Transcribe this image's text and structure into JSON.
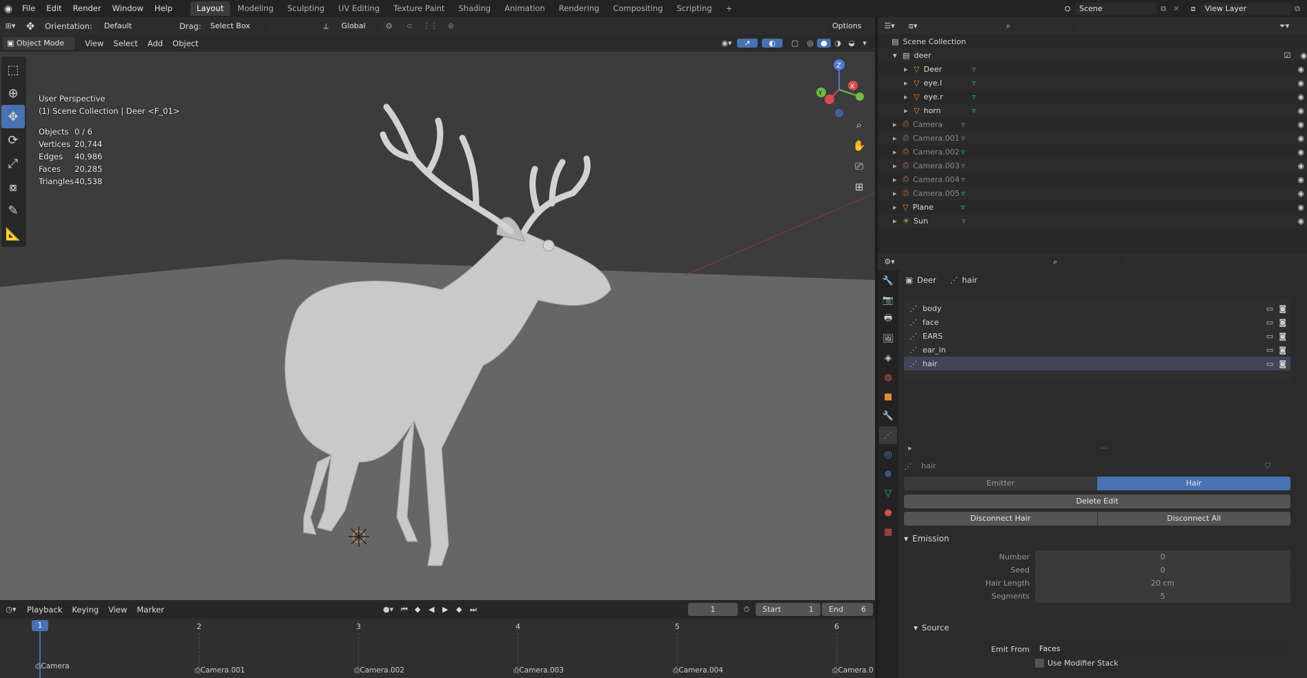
{
  "topbar": {
    "menus": [
      "File",
      "Edit",
      "Render",
      "Window",
      "Help"
    ],
    "workspaces": [
      "Layout",
      "Modeling",
      "Sculpting",
      "UV Editing",
      "Texture Paint",
      "Shading",
      "Animation",
      "Rendering",
      "Compositing",
      "Scripting"
    ],
    "add_tab": "+",
    "scene": "Scene",
    "view_layer": "View Layer"
  },
  "tool_header": {
    "orientation_label": "Orientation:",
    "orientation_value": "Default",
    "drag_label": "Drag:",
    "drag_value": "Select Box",
    "transform_space": "Global",
    "options": "Options"
  },
  "viewport_header": {
    "mode": "Object Mode",
    "menus": [
      "View",
      "Select",
      "Add",
      "Object"
    ]
  },
  "overlay": {
    "perspective": "User Perspective",
    "collection": "(1) Scene Collection | Deer <F_01>",
    "stats": [
      {
        "label": "Objects",
        "value": "0 / 6"
      },
      {
        "label": "Vertices",
        "value": "20,744"
      },
      {
        "label": "Edges",
        "value": "40,986"
      },
      {
        "label": "Faces",
        "value": "20,285"
      },
      {
        "label": "Triangles",
        "value": "40,538"
      }
    ],
    "axes": {
      "z": "Z",
      "y": "Y",
      "x": "X"
    }
  },
  "outliner": {
    "root": "Scene Collection",
    "collection": "deer",
    "items": [
      {
        "name": "Deer",
        "kind": "mesh"
      },
      {
        "name": "eye.l",
        "kind": "mesh"
      },
      {
        "name": "eye.r",
        "kind": "mesh"
      },
      {
        "name": "horn",
        "kind": "mesh"
      },
      {
        "name": "Camera",
        "kind": "camera"
      },
      {
        "name": "Camera.001",
        "kind": "camera"
      },
      {
        "name": "Camera.002",
        "kind": "camera"
      },
      {
        "name": "Camera.003",
        "kind": "camera"
      },
      {
        "name": "Camera.004",
        "kind": "camera"
      },
      {
        "name": "Camera.005",
        "kind": "camera"
      },
      {
        "name": "Plane",
        "kind": "mesh"
      },
      {
        "name": "Sun",
        "kind": "light"
      }
    ]
  },
  "properties": {
    "breadcrumb_object": "Deer",
    "breadcrumb_data": "hair",
    "particle_systems": [
      "body",
      "face",
      "EARS",
      "ear_in",
      "hair"
    ],
    "selected_system": "hair",
    "settings_name": "hair",
    "type_emitter": "Emitter",
    "type_hair": "Hair",
    "delete_edit": "Delete Edit",
    "disconnect_hair": "Disconnect Hair",
    "disconnect_all": "Disconnect All",
    "emission": {
      "title": "Emission",
      "fields": [
        {
          "label": "Number",
          "value": "0"
        },
        {
          "label": "Seed",
          "value": "0"
        },
        {
          "label": "Hair Length",
          "value": "20 cm"
        },
        {
          "label": "Segments",
          "value": "5"
        }
      ]
    },
    "source": {
      "title": "Source",
      "emit_from_label": "Emit From",
      "emit_from_value": "Faces",
      "use_modifier_stack": "Use Modifier Stack"
    }
  },
  "timeline": {
    "menus": [
      "Playback",
      "Keying",
      "View",
      "Marker"
    ],
    "current_frame": "1",
    "start_label": "Start",
    "start": "1",
    "end_label": "End",
    "end": "6",
    "ticks": [
      "1",
      "2",
      "3",
      "4",
      "5",
      "6"
    ],
    "markers": [
      "Camera",
      "Camera.001",
      "Camera.002",
      "Camera.003",
      "Camera.004",
      "Camera.0"
    ]
  },
  "colors": {
    "accent": "#4772b3",
    "mesh_icon": "#e08c3c",
    "data_icon": "#3fc27c",
    "camera_icon": "#c87d50",
    "selected_row": "#40455a"
  }
}
